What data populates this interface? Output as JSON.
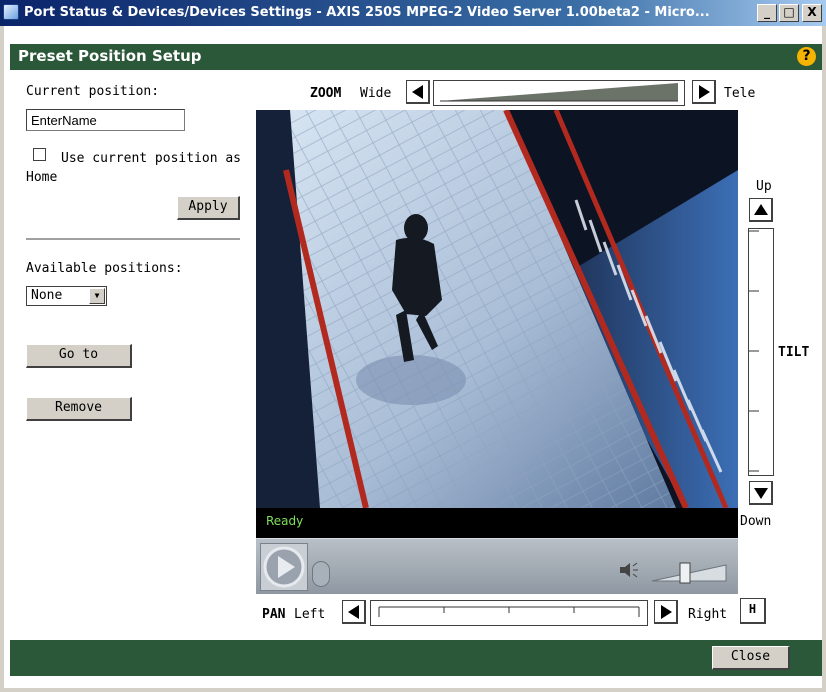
{
  "window": {
    "title": "Port Status & Devices/Devices Settings - AXIS 250S MPEG-2 Video Server 1.00beta2 - Micro...",
    "minimize": "_",
    "maximize": "□",
    "close": "X"
  },
  "header": {
    "title": "Preset Position Setup",
    "help": "?"
  },
  "left_panel": {
    "current_position_label": "Current position:",
    "current_position_value": "EnterName",
    "home_checkbox_label_1": "Use current position as",
    "home_checkbox_label_2": "Home",
    "home_checked": false,
    "apply_label": "Apply",
    "available_positions_label": "Available positions:",
    "available_positions_selected": "None",
    "goto_label": "Go to",
    "remove_label": "Remove"
  },
  "zoom": {
    "label": "ZOOM",
    "wide_label": "Wide",
    "tele_label": "Tele",
    "level": 0.0
  },
  "tilt": {
    "up_label": "Up",
    "down_label": "Down",
    "label": "TILT"
  },
  "pan": {
    "label": "PAN",
    "left_label": "Left",
    "right_label": "Right",
    "home_label": "H"
  },
  "video": {
    "status": "Ready",
    "volume_level": 0.35
  },
  "footer": {
    "close_label": "Close"
  },
  "colors": {
    "header_green": "#2b5839",
    "status_text": "#7ee05a",
    "help_badge": "#f5b400"
  }
}
